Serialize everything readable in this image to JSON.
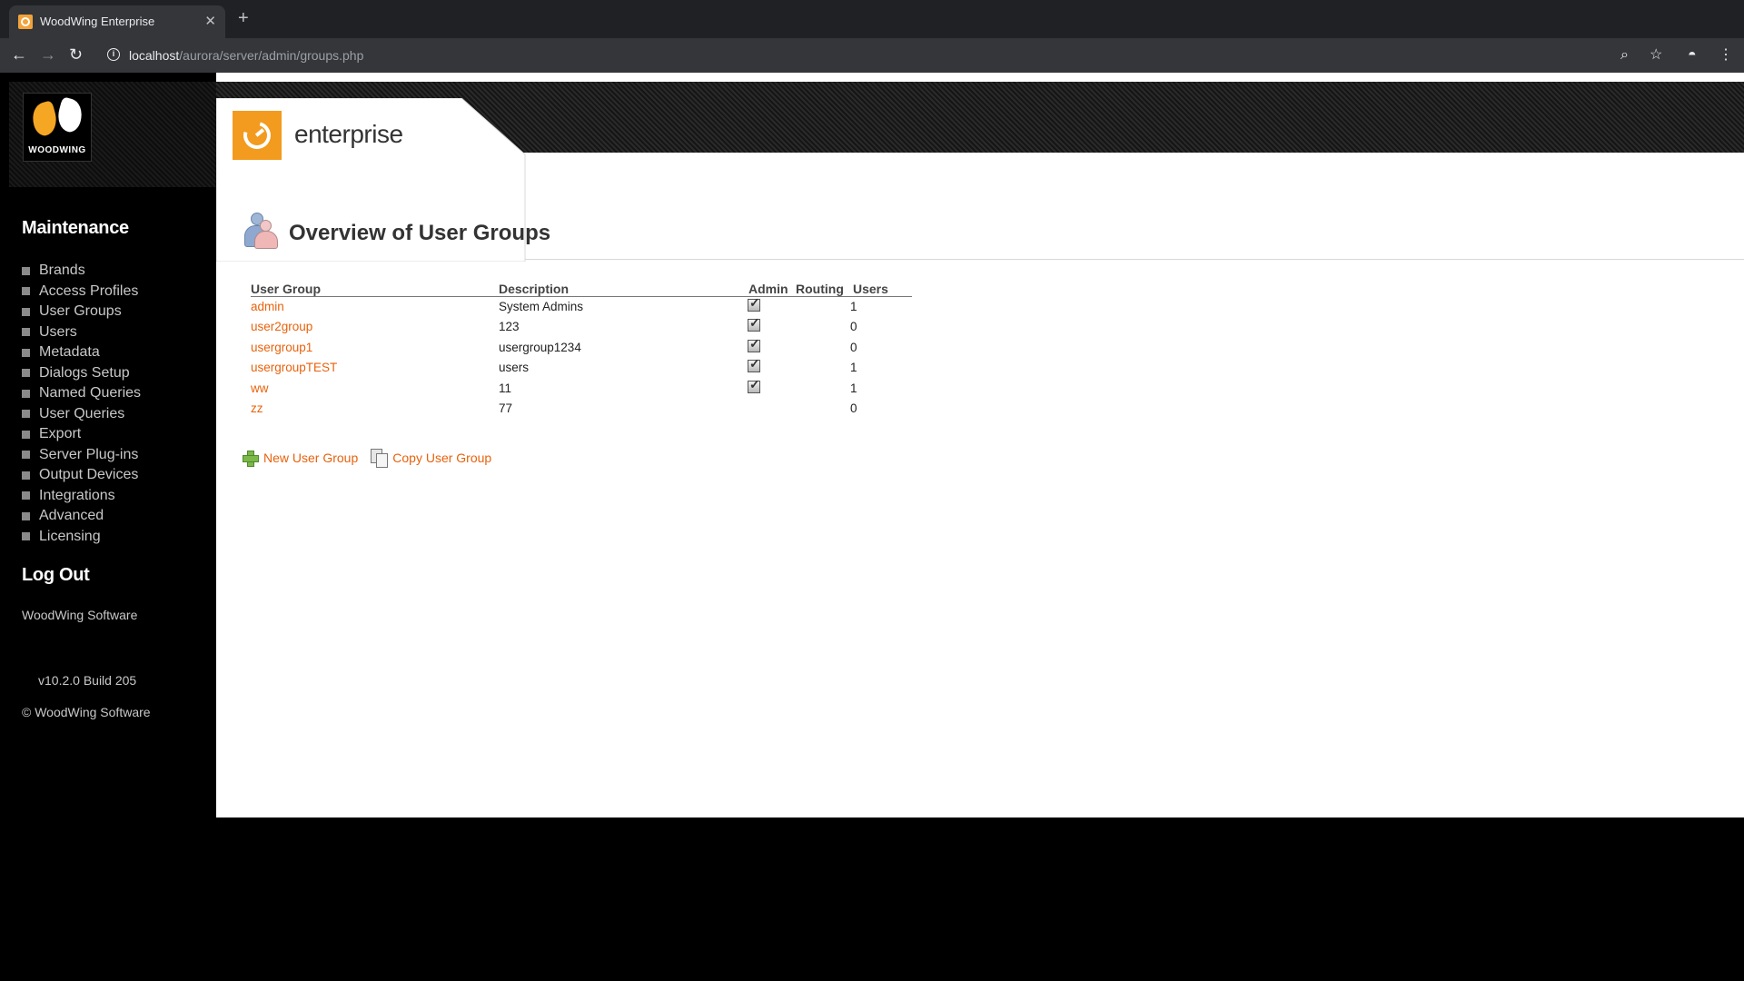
{
  "browser": {
    "tab_title": "WoodWing Enterprise",
    "url_host": "localhost",
    "url_path": "/aurora/server/admin/groups.php"
  },
  "logo": {
    "text": "WOODWING"
  },
  "brand": {
    "product": "enterprise"
  },
  "sidebar": {
    "maintenance_heading": "Maintenance",
    "items": [
      {
        "label": "Brands"
      },
      {
        "label": "Access Profiles"
      },
      {
        "label": "User Groups"
      },
      {
        "label": "Users"
      },
      {
        "label": "Metadata"
      },
      {
        "label": "Dialogs Setup"
      },
      {
        "label": "Named Queries"
      },
      {
        "label": "User Queries"
      },
      {
        "label": "Export"
      },
      {
        "label": "Server Plug-ins"
      },
      {
        "label": "Output Devices"
      },
      {
        "label": "Integrations"
      },
      {
        "label": "Advanced"
      },
      {
        "label": "Licensing"
      }
    ],
    "logout_label": "Log Out",
    "company": "WoodWing Software",
    "version": "v10.2.0 Build 205",
    "copyright": "© WoodWing Software"
  },
  "main": {
    "title": "Overview of User Groups",
    "table": {
      "headers": [
        "User Group",
        "Description",
        "Admin",
        "Routing",
        "Users"
      ],
      "rows": [
        {
          "group": "admin",
          "description": "System Admins",
          "admin": true,
          "routing": false,
          "users": "1"
        },
        {
          "group": "user2group",
          "description": "123",
          "admin": true,
          "routing": false,
          "users": "0"
        },
        {
          "group": "usergroup1",
          "description": "usergroup1234",
          "admin": true,
          "routing": false,
          "users": "0"
        },
        {
          "group": "usergroupTEST",
          "description": "users",
          "admin": true,
          "routing": false,
          "users": "1"
        },
        {
          "group": "ww",
          "description": "11",
          "admin": true,
          "routing": false,
          "users": "1"
        },
        {
          "group": "zz",
          "description": "77",
          "admin": false,
          "routing": false,
          "users": "0"
        }
      ]
    },
    "actions": {
      "new_label": "New User Group",
      "copy_label": "Copy User Group"
    }
  },
  "colors": {
    "link": "#e8620c",
    "brand_orange": "#f29b1f"
  }
}
